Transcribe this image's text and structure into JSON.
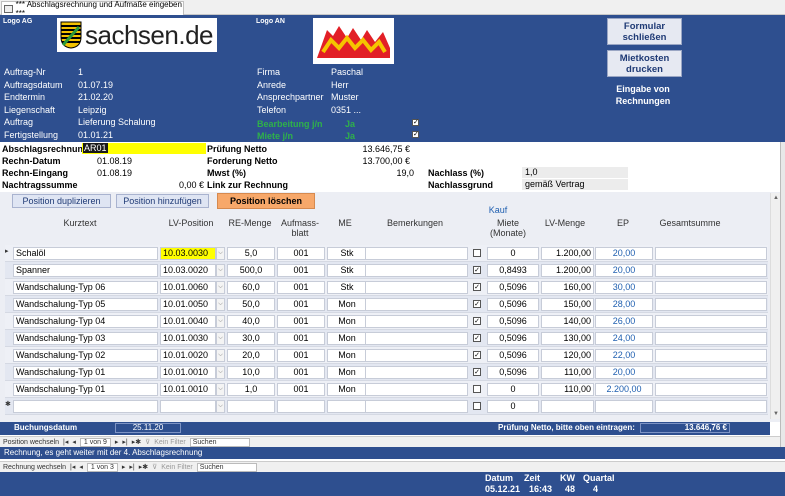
{
  "window": {
    "tab_title": "*** Abschlagsrechnung und Aufmaße eingeben ***"
  },
  "header": {
    "logo_ag_label": "Logo AG",
    "logo_an_label": "Logo AN",
    "sachsen_logo_text": "sachsen.de",
    "btn_close": "Formular schließen",
    "btn_print": "Mietkosten drucken",
    "eingabe_label": "Eingabe von Rechnungen",
    "left_fields": [
      {
        "label": "Auftrag-Nr",
        "value": "1"
      },
      {
        "label": "Auftragsdatum",
        "value": "01.07.19"
      },
      {
        "label": "Endtermin",
        "value": "21.02.20"
      },
      {
        "label": "Liegenschaft",
        "value": "Leipzig"
      },
      {
        "label": "Auftrag",
        "value": "Lieferung Schalung"
      },
      {
        "label": "Fertigstellung",
        "value": "01.01.21"
      }
    ],
    "right_fields": [
      {
        "label": "Firma",
        "value": "Paschal"
      },
      {
        "label": "Anrede",
        "value": "Herr"
      },
      {
        "label": "Ansprechpartner",
        "value": "Muster"
      },
      {
        "label": "Telefon",
        "value": "0351 ..."
      }
    ],
    "bearbeitung_label": "Bearbeitung j/n",
    "bearbeitung_value": "Ja",
    "miete_label": "Miete j/n",
    "miete_value": "Ja"
  },
  "info": {
    "abschlag_label": "Abschlagsrechnung",
    "abschlag_value": "AR01",
    "rechn_datum_label": "Rechn-Datum",
    "rechn_datum_value": "01.08.19",
    "rechn_eingang_label": "Rechn-Eingang",
    "rechn_eingang_value": "01.08.19",
    "nachtrag_label": "Nachtragssumme",
    "nachtrag_value": "0,00 €",
    "pruefung_label": "Prüfung Netto",
    "pruefung_value": "13.646,75 €",
    "forderung_label": "Forderung Netto",
    "forderung_value": "13.700,00 €",
    "mwst_label": "Mwst (%)",
    "mwst_value": "19,0",
    "link_label": "Link zur Rechnung",
    "nachlass_label": "Nachlass (%)",
    "nachlass_value": "1,0",
    "nachlassgrund_label": "Nachlassgrund",
    "nachlassgrund_value": "gemäß Vertrag"
  },
  "toolbar": {
    "dup": "Position duplizieren",
    "add": "Position hinzufügen",
    "del": "Position löschen"
  },
  "columns": {
    "kurztext": "Kurztext",
    "lvpos": "LV-Position",
    "remenge": "RE-Menge",
    "aufmass": "Aufmass-blatt",
    "me": "ME",
    "bem": "Bemerkungen",
    "kauf": "Kauf",
    "miete": "Miete (Monate)",
    "lvmenge": "LV-Menge",
    "ep": "EP",
    "gesamt": "Gesamtsumme"
  },
  "rows": [
    {
      "kurztext": "Schalöl",
      "lvpos": "10.03.0030",
      "remenge": "5,0",
      "aufmass": "001",
      "me": "Stk",
      "kauf": false,
      "miete": "0",
      "lvmenge": "1.200,00",
      "ep": "20,00"
    },
    {
      "kurztext": "Spanner",
      "lvpos": "10.03.0020",
      "remenge": "500,0",
      "aufmass": "001",
      "me": "Stk",
      "kauf": true,
      "miete": "0,8493",
      "lvmenge": "1.200,00",
      "ep": "20,00"
    },
    {
      "kurztext": "Wandschalung-Typ 06",
      "lvpos": "10.01.0060",
      "remenge": "60,0",
      "aufmass": "001",
      "me": "Stk",
      "kauf": true,
      "miete": "0,5096",
      "lvmenge": "160,00",
      "ep": "30,00"
    },
    {
      "kurztext": "Wandschalung-Typ 05",
      "lvpos": "10.01.0050",
      "remenge": "50,0",
      "aufmass": "001",
      "me": "Mon",
      "kauf": true,
      "miete": "0,5096",
      "lvmenge": "150,00",
      "ep": "28,00"
    },
    {
      "kurztext": "Wandschalung-Typ 04",
      "lvpos": "10.01.0040",
      "remenge": "40,0",
      "aufmass": "001",
      "me": "Mon",
      "kauf": true,
      "miete": "0,5096",
      "lvmenge": "140,00",
      "ep": "26,00"
    },
    {
      "kurztext": "Wandschalung-Typ 03",
      "lvpos": "10.01.0030",
      "remenge": "30,0",
      "aufmass": "001",
      "me": "Mon",
      "kauf": true,
      "miete": "0,5096",
      "lvmenge": "130,00",
      "ep": "24,00"
    },
    {
      "kurztext": "Wandschalung-Typ 02",
      "lvpos": "10.01.0020",
      "remenge": "20,0",
      "aufmass": "001",
      "me": "Mon",
      "kauf": true,
      "miete": "0,5096",
      "lvmenge": "120,00",
      "ep": "22,00"
    },
    {
      "kurztext": "Wandschalung-Typ 01",
      "lvpos": "10.01.0010",
      "remenge": "10,0",
      "aufmass": "001",
      "me": "Mon",
      "kauf": true,
      "miete": "0,5096",
      "lvmenge": "110,00",
      "ep": "20,00"
    },
    {
      "kurztext": "Wandschalung-Typ 01",
      "lvpos": "10.01.0010",
      "remenge": "1,0",
      "aufmass": "001",
      "me": "Mon",
      "kauf": false,
      "miete": "0",
      "lvmenge": "110,00",
      "ep": "2.200,00"
    },
    {
      "kurztext": "",
      "lvpos": "",
      "remenge": "",
      "aufmass": "",
      "me": "",
      "kauf": false,
      "miete": "0",
      "lvmenge": "",
      "ep": ""
    }
  ],
  "footer": {
    "buchungsdatum_label": "Buchungsdatum",
    "buchungsdatum_value": "25.11.20",
    "pruefung_hint": "Prüfung Netto, bitte oben eintragen:",
    "pruefung_total": "13.646,76 €"
  },
  "nav1": {
    "label": "Position wechseln",
    "record": "1 von 9",
    "filter": "Kein Filter",
    "search": "Suchen"
  },
  "status": "Rechnung, es geht weiter mit der 4. Abschlagsrechnung",
  "nav2": {
    "label": "Rechnung wechseln",
    "record": "1 von 3",
    "filter": "Kein Filter",
    "search": "Suchen"
  },
  "bottom": {
    "datum_label": "Datum",
    "datum_value": "05.12.21",
    "zeit_label": "Zeit",
    "zeit_value": "16:43",
    "kw_label": "KW",
    "kw_value": "48",
    "quartal_label": "Quartal",
    "quartal_value": "4"
  },
  "colors": {
    "header_bg": "#2e4f8f",
    "highlight_yellow": "#ffff00",
    "delete_btn": "#f7a86a",
    "green_label": "#2fb14a"
  }
}
